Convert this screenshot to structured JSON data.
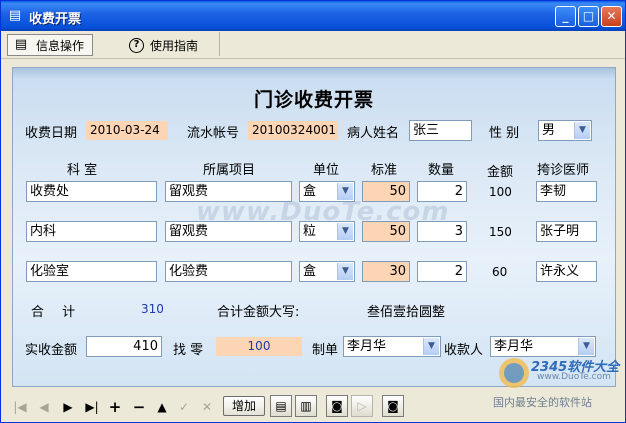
{
  "window": {
    "title": "收费开票",
    "minimize": "_",
    "maximize": "□",
    "close": "✕"
  },
  "menu": {
    "items": [
      {
        "label": "信息操作",
        "icon": "info-card-icon"
      },
      {
        "label": "使用指南",
        "icon": "help-icon"
      }
    ]
  },
  "form": {
    "title": "门诊收费开票",
    "charge_date_label": "收费日期",
    "charge_date": "2010-03-24",
    "serial_label": "流水帐号",
    "serial": "20100324001",
    "patient_label": "病人姓名",
    "patient": "张三",
    "gender_label": "性 别",
    "gender": "男"
  },
  "table": {
    "headers": [
      "科 室",
      "所属项目",
      "单位",
      "标准",
      "数量",
      "金额",
      "挎诊医师"
    ],
    "rows": [
      {
        "dept": "收费处",
        "item": "留观费",
        "unit": "盒",
        "price": "50",
        "qty": "2",
        "amount": "100",
        "doctor": "李韧"
      },
      {
        "dept": "内科",
        "item": "留观费",
        "unit": "粒",
        "price": "50",
        "qty": "3",
        "amount": "150",
        "doctor": "张子明"
      },
      {
        "dept": "化验室",
        "item": "化验费",
        "unit": "盒",
        "price": "30",
        "qty": "2",
        "amount": "60",
        "doctor": "许永义"
      }
    ]
  },
  "totals": {
    "total_label": "合 计",
    "total": "310",
    "uppercase_label": "合计金额大写:",
    "uppercase": "叁佰壹拾圆整"
  },
  "payment": {
    "received_label": "实收金额",
    "received": "410",
    "change_label": "找 零",
    "change": "100",
    "maker_label": "制单",
    "maker": "李月华",
    "cashier_label": "收款人",
    "cashier": "李月华"
  },
  "toolbar": {
    "add_label": "增加"
  },
  "watermark": {
    "text": "www.DuoTe.com",
    "logo": "2345软件大全",
    "logo_sub": "www.DuoTe.com",
    "caption": "国内最安全的软件站"
  }
}
